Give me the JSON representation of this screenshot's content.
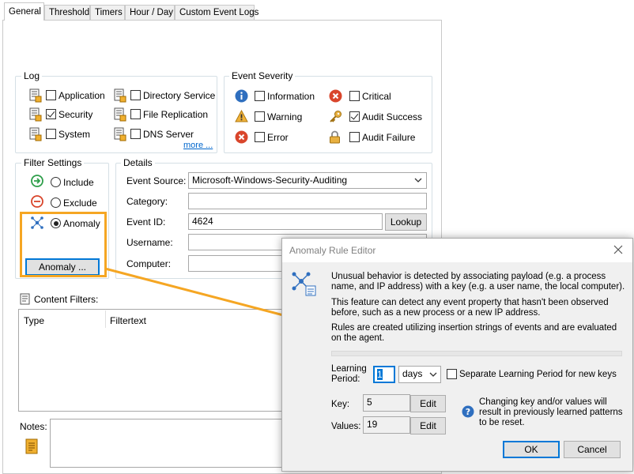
{
  "tabs": [
    "General",
    "Threshold",
    "Timers",
    "Hour / Day",
    "Custom Event Logs"
  ],
  "log": {
    "title": "Log",
    "items": [
      {
        "label": "Application",
        "checked": false
      },
      {
        "label": "Security",
        "checked": true
      },
      {
        "label": "System",
        "checked": false
      },
      {
        "label": "Directory Service",
        "checked": false
      },
      {
        "label": "File Replication",
        "checked": false
      },
      {
        "label": "DNS Server",
        "checked": false
      }
    ],
    "more_label": "more ..."
  },
  "severity": {
    "title": "Event Severity",
    "items": [
      {
        "label": "Information",
        "checked": false,
        "icon": "info-icon"
      },
      {
        "label": "Warning",
        "checked": false,
        "icon": "warning-icon"
      },
      {
        "label": "Error",
        "checked": false,
        "icon": "error-icon"
      },
      {
        "label": "Critical",
        "checked": false,
        "icon": "critical-icon"
      },
      {
        "label": "Audit Success",
        "checked": true,
        "icon": "key-icon"
      },
      {
        "label": "Audit Failure",
        "checked": false,
        "icon": "lock-icon"
      }
    ]
  },
  "filter": {
    "title": "Filter Settings",
    "options": [
      {
        "label": "Include",
        "selected": false
      },
      {
        "label": "Exclude",
        "selected": false
      },
      {
        "label": "Anomaly",
        "selected": true
      }
    ],
    "anomaly_button": "Anomaly ..."
  },
  "details": {
    "title": "Details",
    "event_source_label": "Event Source:",
    "event_source_value": "Microsoft-Windows-Security-Auditing",
    "category_label": "Category:",
    "category_value": "",
    "event_id_label": "Event ID:",
    "event_id_value": "4624",
    "lookup_button": "Lookup",
    "username_label": "Username:",
    "computer_label": "Computer:"
  },
  "content_filters": {
    "title": "Content Filters:",
    "columns": [
      "Type",
      "Filtertext"
    ]
  },
  "notes_label": "Notes:",
  "dialog": {
    "title": "Anomaly Rule Editor",
    "para1": "Unusual behavior is detected by associating payload (e.g. a process name, and IP address) with a key (e.g. a user name, the local computer).",
    "para2": "This feature can detect any event property that hasn't been observed before, such as a new process or a new IP address.",
    "para3": "Rules are created utilizing insertion strings of events and are evaluated on the agent.",
    "learning_label_1": "Learning",
    "learning_label_2": "Period:",
    "learning_value": "1",
    "learning_unit": "days",
    "separate_label": "Separate Learning Period for new keys",
    "key_label": "Key:",
    "key_value": "5",
    "values_label": "Values:",
    "values_value": "19",
    "edit_label": "Edit",
    "warning_text": "Changing key and/or values will result in previously learned patterns to be reset.",
    "ok_label": "OK",
    "cancel_label": "Cancel"
  },
  "colors": {
    "highlight": "#f5a623",
    "info": "#2f6fbf",
    "error": "#d9452b",
    "accent_blue": "#0078d7"
  }
}
